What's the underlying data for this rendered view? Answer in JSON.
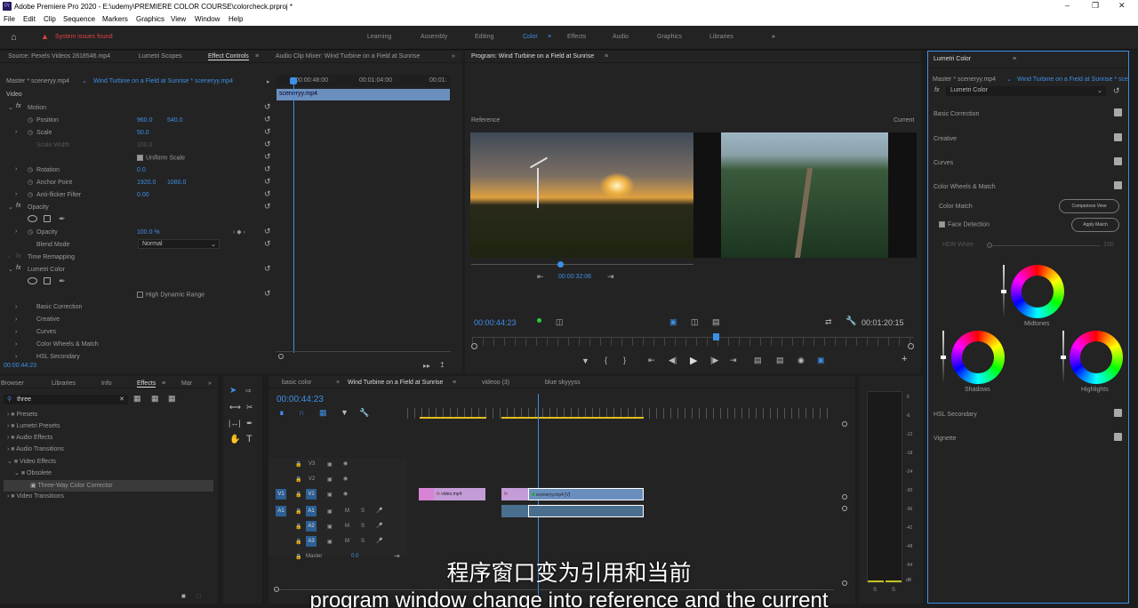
{
  "window": {
    "title": "Adobe Premiere Pro 2020 - E:\\udemy\\PREMIERE COLOR COURSE\\colorcheck.prproj *"
  },
  "menu": [
    "File",
    "Edit",
    "Clip",
    "Sequence",
    "Markers",
    "Graphics",
    "View",
    "Window",
    "Help"
  ],
  "workspace": {
    "alert": "System issues found",
    "tabs": [
      "Learning",
      "Assembly",
      "Editing",
      "Color",
      "Effects",
      "Audio",
      "Graphics",
      "Libraries"
    ],
    "active": "Color"
  },
  "source_panel": {
    "tabs": [
      "Source: Pexels Videos 2818546.mp4",
      "Lumetri Scopes",
      "Effect Controls",
      "Audio Clip Mixer: Wind Turbine on a Field at Sunrise"
    ],
    "master": "Master * sceneryy.mp4",
    "sequence": "Wind Turbine on a Field at Sunrise * sceneryy.mp4",
    "ruler": [
      "00:00:48:00",
      "00:01:04:00",
      "00:01:"
    ],
    "clip": "sceneryy.mp4",
    "section": "Video",
    "motion": "Motion",
    "position": {
      "label": "Position",
      "x": "960.0",
      "y": "540.0"
    },
    "scale": {
      "label": "Scale",
      "value": "50.0"
    },
    "scale_width": {
      "label": "Scale Width",
      "value": "100.0"
    },
    "uniform": "Uniform Scale",
    "rotation": {
      "label": "Rotation",
      "value": "0.0"
    },
    "anchor": {
      "label": "Anchor Point",
      "x": "1920.0",
      "y": "1080.0"
    },
    "antiflicker": {
      "label": "Anti-flicker Filter",
      "value": "0.00"
    },
    "opacity_fx": "Opacity",
    "opacity": {
      "label": "Opacity",
      "value": "100.0 %"
    },
    "blend": {
      "label": "Blend Mode",
      "value": "Normal"
    },
    "time_remap": "Time Remapping",
    "lumetri": "Lumetri Color",
    "hdr": "High Dynamic Range",
    "lumetri_items": [
      "Basic Correction",
      "Creative",
      "Curves",
      "Color Wheels & Match",
      "HSL Secondary"
    ],
    "timecode": "00:00:44:23"
  },
  "program": {
    "title": "Program: Wind Turbine on a Field at Sunrise",
    "reference": "Reference",
    "current": "Current",
    "ref_time": "00:00:32:06",
    "timecode": "00:00:44:23",
    "duration": "00:01:20:15"
  },
  "lumetri_panel": {
    "title": "Lumetri Color",
    "master": "Master * sceneryy.mp4",
    "sequence": "Wind Turbine on a Field at Sunrise * sceneryy.mp4",
    "effect": "Lumetri Color",
    "sections": [
      "Basic Correction",
      "Creative",
      "Curves",
      "Color Wheels & Match"
    ],
    "color_match": "Color Match",
    "comparison_view": "Comparison View",
    "face_detection": "Face Detection",
    "apply_match": "Apply Match",
    "hdr_white": "HDR White",
    "hdr_value": "100",
    "wheels": {
      "midtones": "Midtones",
      "shadows": "Shadows",
      "highlights": "Highlights"
    },
    "bottom": [
      "HSL Secondary",
      "Vignette"
    ]
  },
  "effects_panel": {
    "tabs": [
      "Browser",
      "Libraries",
      "Info",
      "Effects",
      "Mar"
    ],
    "search": "three",
    "tree": [
      "Presets",
      "Lumetri Presets",
      "Audio Effects",
      "Audio Transitions",
      "Video Effects",
      "Obsolete",
      "Three-Way Color Corrector",
      "Video Transitions"
    ]
  },
  "timeline": {
    "tabs": [
      "basic color",
      "Wind Turbine on a Field at Sunrise",
      "videoo (3)",
      "blue skyyyss"
    ],
    "timecode": "00:00:44:23",
    "tracks": [
      "V3",
      "V2",
      "V1",
      "A1",
      "A2",
      "A3"
    ],
    "master": "Master",
    "master_val": "0.0",
    "clips": {
      "v1a": "video.mp4",
      "v1b": "fx",
      "v1c": "sceneryy.mp4 [V]"
    }
  },
  "meter": [
    "0",
    "-6",
    "-12",
    "-18",
    "-24",
    "-30",
    "-36",
    "-42",
    "-48",
    "-54",
    "dB"
  ],
  "subtitles": {
    "zh": "程序窗口变为引用和当前",
    "en": "program window change into reference and the current"
  },
  "colors": {
    "accent": "#3e8fe6",
    "alert": "#e04040"
  }
}
